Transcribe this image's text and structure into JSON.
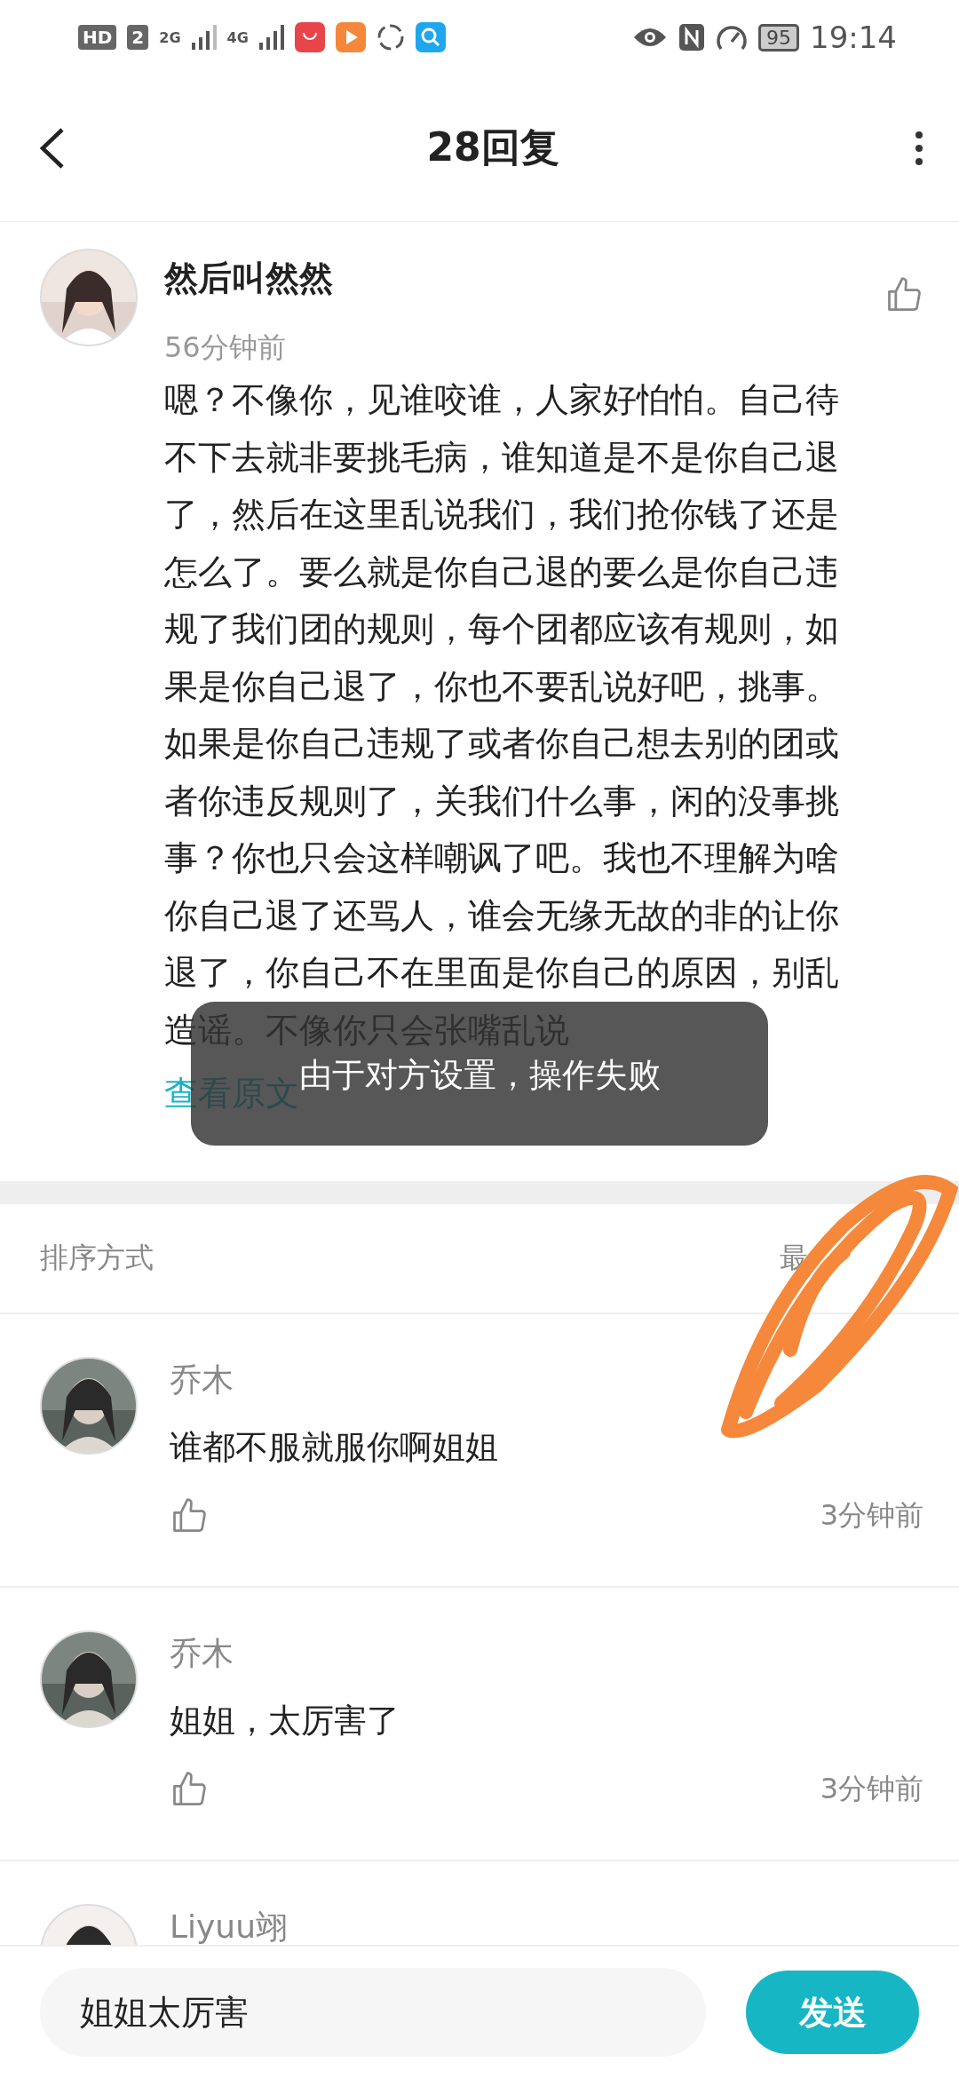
{
  "status_bar": {
    "network_labels": [
      "HD",
      "2",
      "2G",
      "4G"
    ],
    "battery": "95",
    "time": "19:14"
  },
  "header": {
    "title": "28回复"
  },
  "post": {
    "author": "然后叫然然",
    "time": "56分钟前",
    "body_lines": [
      "嗯？不像你，见谁咬谁，人家好怕怕。自己待",
      "不下去就非要挑毛病，谁知道是不是你自己退",
      "了，然后在这里乱说我们，我们抢你钱了还是",
      "怎么了。要么就是你自己退的要么是你自己违",
      "规了我们团的规则，每个团都应该有规则，如",
      "果是你自己退了，你也不要乱说好吧，挑事。",
      "如果是你自己违规了或者你自己想去别的团或",
      "者你违反规则了，关我们什么事，闲的没事挑",
      "事？你也只会这样嘲讽了吧。我也不理解为啥",
      "你自己退了还骂人，谁会无缘无故的非的让你",
      "退了，你自己不在里面是你自己的原因，别乱",
      "造谣。不像你只会张嘴乱说"
    ],
    "view_original": "查看原文"
  },
  "toast": {
    "text": "由于对方设置，操作失败"
  },
  "sort": {
    "label": "排序方式",
    "value": "最"
  },
  "comments": [
    {
      "author": "乔木",
      "text": "谁都不服就服你啊姐姐",
      "time": "3分钟前"
    },
    {
      "author": "乔木",
      "text": "姐姐，太厉害了",
      "time": "3分钟前"
    },
    {
      "author": "Liyuu翊"
    }
  ],
  "composer": {
    "value": "姐姐太厉害",
    "send": "发送"
  }
}
